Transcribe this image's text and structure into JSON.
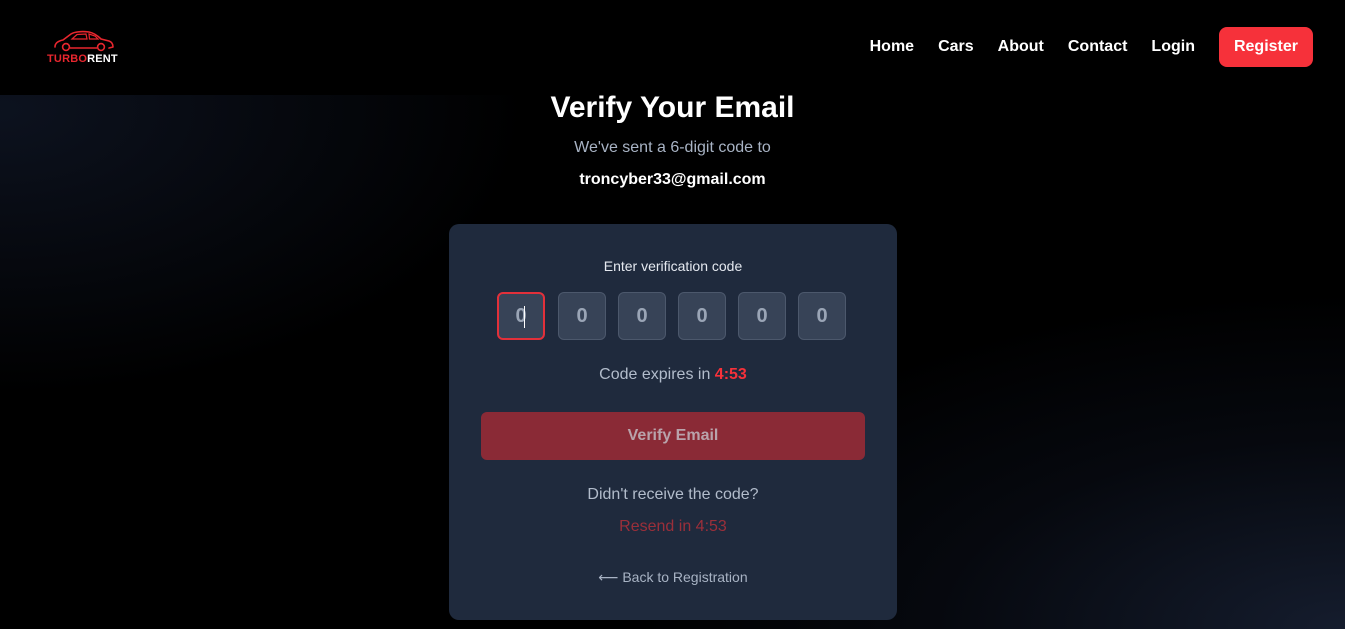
{
  "brand": {
    "part1": "TURBO",
    "part2": "RENT",
    "accent_color": "#f6313a"
  },
  "nav": {
    "items": [
      {
        "label": "Home"
      },
      {
        "label": "Cars"
      },
      {
        "label": "About"
      },
      {
        "label": "Contact"
      },
      {
        "label": "Login"
      }
    ],
    "register_label": "Register"
  },
  "heading": {
    "title": "Verify Your Email",
    "subtitle": "We've sent a 6-digit code to",
    "email": "troncyber33@gmail.com"
  },
  "card": {
    "label": "Enter verification code",
    "otp_placeholders": [
      "0",
      "0",
      "0",
      "0",
      "0",
      "0"
    ],
    "expires_text": "Code expires in",
    "expires_timer": "4:53",
    "verify_label": "Verify Email",
    "didnt_receive": "Didn't receive the code?",
    "resend_label": "Resend in 4:53",
    "back_label": "⟵ Back to Registration"
  }
}
